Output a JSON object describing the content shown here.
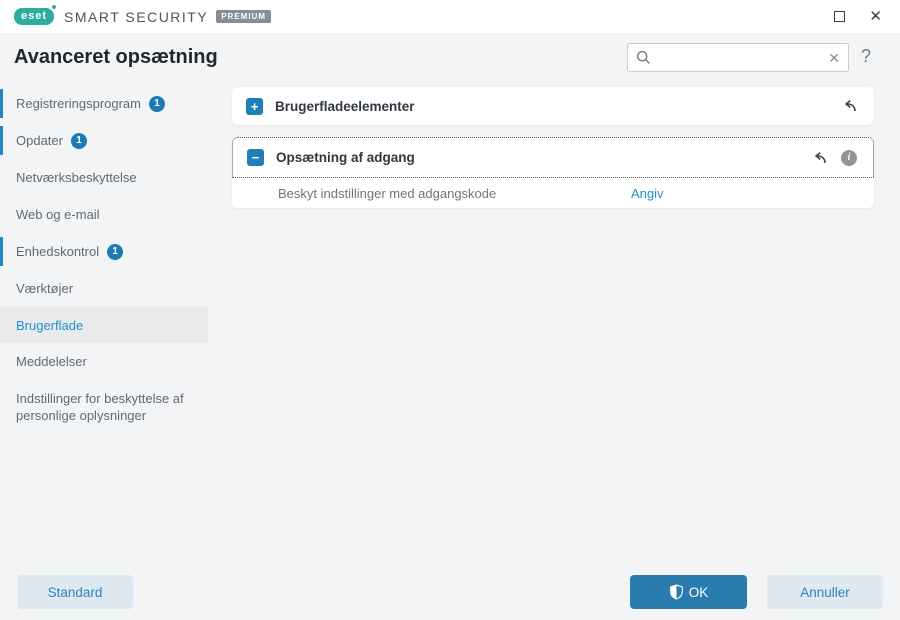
{
  "titlebar": {
    "logo_text": "eset",
    "product_name": "SMART SECURITY",
    "tier_badge": "PREMIUM",
    "close_glyph": "✕"
  },
  "header": {
    "title": "Avanceret opsætning",
    "search": {
      "value": "",
      "placeholder": "",
      "clear_glyph": "✕"
    },
    "help_label": "?"
  },
  "sidebar": {
    "items": [
      {
        "label": "Registreringsprogram",
        "badge": "1"
      },
      {
        "label": "Opdater",
        "badge": "1"
      },
      {
        "label": "Netværksbeskyttelse",
        "badge": ""
      },
      {
        "label": "Web og e-mail",
        "badge": ""
      },
      {
        "label": "Enhedskontrol",
        "badge": "1"
      },
      {
        "label": "Værktøjer",
        "badge": ""
      },
      {
        "label": "Brugerflade",
        "badge": ""
      },
      {
        "label": "Meddelelser",
        "badge": ""
      },
      {
        "label": "Indstillinger for beskyttelse af personlige oplysninger",
        "badge": ""
      }
    ],
    "active_item": "Brugerflade"
  },
  "main": {
    "sections": [
      {
        "title": "Brugerfladeelementer",
        "toggle_glyph": "+",
        "expanded": false
      },
      {
        "title": "Opsætning af adgang",
        "toggle_glyph": "−",
        "expanded": true,
        "info_glyph": "i",
        "rows": [
          {
            "label": "Beskyt indstillinger med adgangskode",
            "link": "Angiv"
          }
        ]
      }
    ]
  },
  "footer": {
    "standard_label": "Standard",
    "ok_label": "OK",
    "cancel_label": "Annuller"
  },
  "colors": {
    "accent_blue": "#2585c0",
    "badge_blue": "#1d7ab3",
    "ok_button_blue": "#2a7cae",
    "eset_teal": "#2eaca0",
    "background": "#f3f4f5",
    "panel_white": "#ffffff"
  }
}
